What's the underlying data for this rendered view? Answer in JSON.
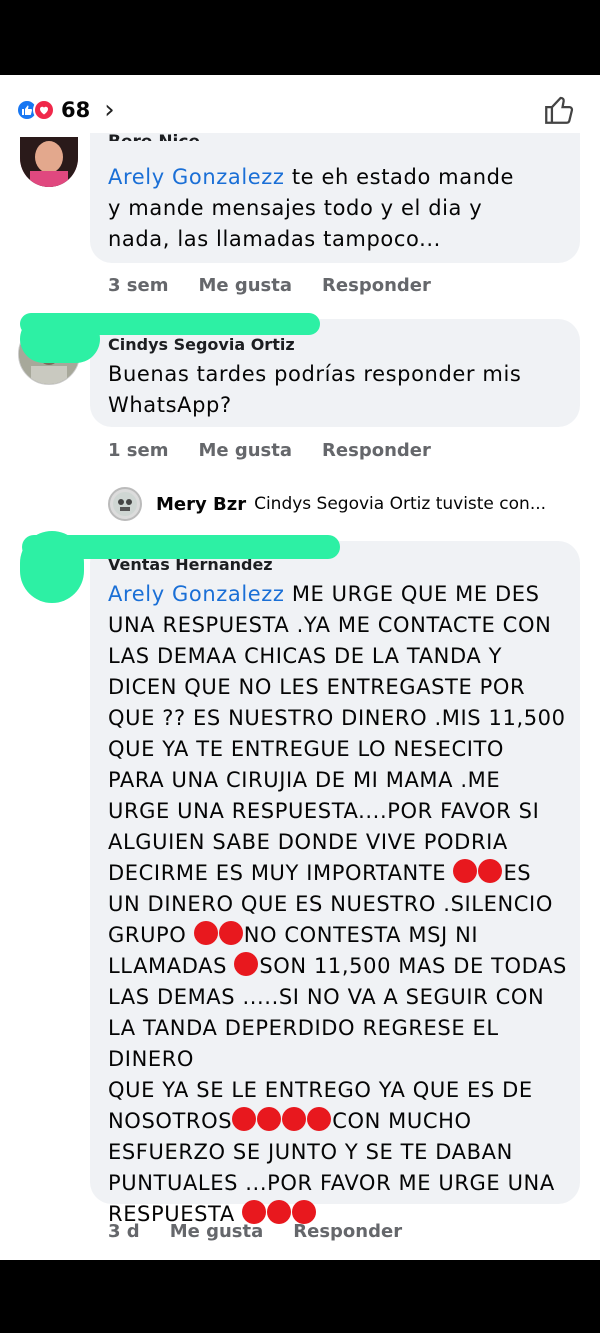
{
  "reactions": {
    "count": "68",
    "types": [
      "like-icon",
      "love-icon"
    ]
  },
  "comments": [
    {
      "author": "Bere Nice",
      "mention": "Arely Gonzalezz",
      "lines": [
        "te eh estado mande",
        "y mande mensajes todo y el dia y",
        "nada, las llamadas tampoco..."
      ],
      "time": "3 sem",
      "like": "Me gusta",
      "reply": "Responder"
    },
    {
      "author": "Cindys Segovia Ortiz",
      "lines": [
        "Buenas tardes podrías responder mis",
        "WhatsApp?"
      ],
      "time": "1 sem",
      "like": "Me gusta",
      "reply": "Responder",
      "reply_preview": {
        "name": "Mery Bzr",
        "text": "Cindys Segovia Ortiz tuviste con..."
      }
    },
    {
      "author": "Ventas Hernandez",
      "mention": "Arely Gonzalezz",
      "lines": [
        "ME URGE QUE ME DES",
        "UNA RESPUESTA .YA ME CONTACTE CON",
        "LAS DEMAA CHICAS DE LA TANDA Y",
        "DICEN QUE  NO LES ENTREGASTE POR",
        "QUE ?? ES NUESTRO DINERO .MIS 11,500",
        "QUE YA TE ENTREGUE LO NESECITO",
        "PARA UNA CIRUJIA DE MI MAMA .ME",
        "URGE UNA RESPUESTA....POR FAVOR SI",
        "ALGUIEN SABE DONDE VIVE PODRIA",
        "DECIRME ES MUY IMPORTANTE ",
        "ES",
        "UN DINERO QUE ES NUESTRO .SILENCIO",
        "GRUPO ",
        "NO CONTESTA MSJ NI",
        "LLAMADAS ",
        "SON 11,500 MAS DE TODAS",
        "LAS DEMAS .....SI NO VA A SEGUIR CON",
        "LA TANDA DEPERDIDO REGRESE EL DINERO",
        "QUE YA SE LE ENTREGO YA QUE ES DE",
        "NOSOTROS",
        "CON MUCHO",
        "ESFUERZO SE JUNTO Y SE TE DABAN",
        "PUNTUALES ...POR FAVOR ME URGE UNA",
        "RESPUESTA "
      ],
      "time": "3 d",
      "like": "Me gusta",
      "reply": "Responder"
    }
  ],
  "emoji_name": "red-circle-emoji",
  "colors": {
    "redaction": "#2df0a4",
    "mention": "#1a6fd6",
    "bubble": "#f0f2f5",
    "red": "#e8181e"
  }
}
